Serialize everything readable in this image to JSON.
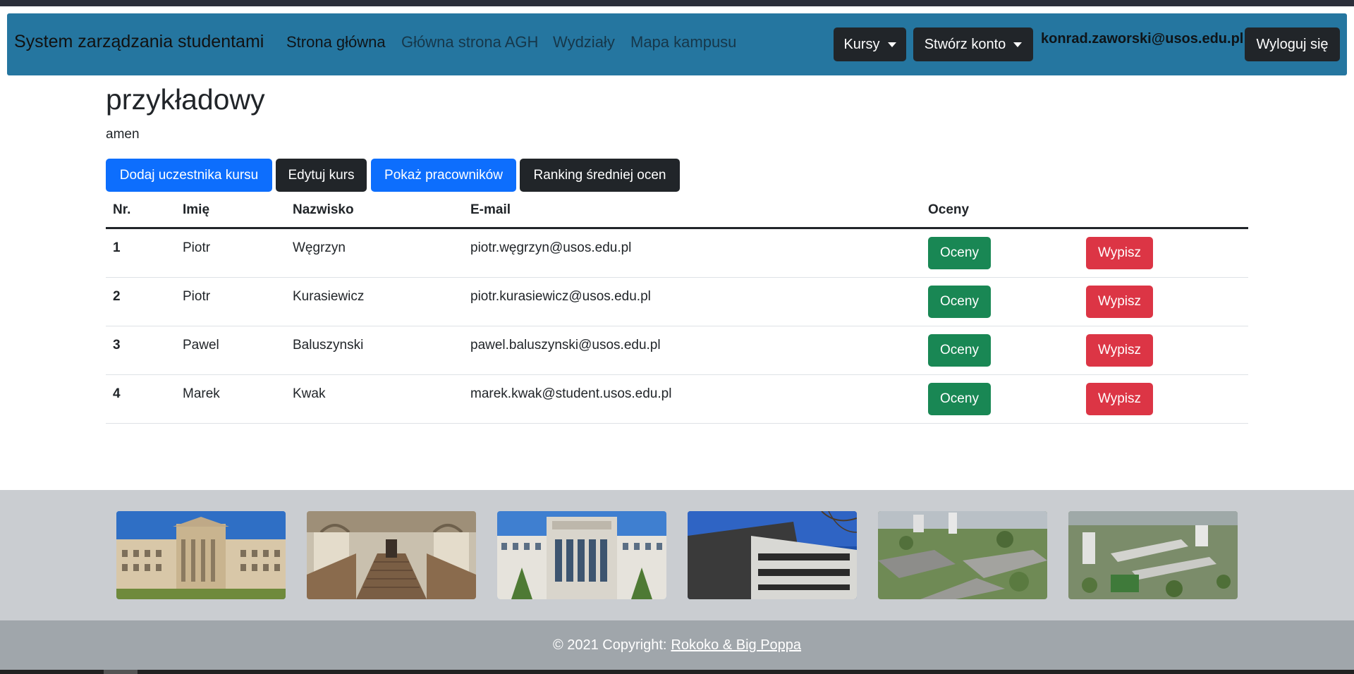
{
  "navbar": {
    "brand": "System zarządzania studentami",
    "links": [
      "Strona główna",
      "Główna strona AGH",
      "Wydziały",
      "Mapa kampusu"
    ],
    "dropdowns": [
      "Kursy",
      "Stwórz konto"
    ],
    "user_email": "konrad.zaworski@usos.edu.pl",
    "logout_label": "Wyloguj się"
  },
  "course": {
    "title": "przykładowy",
    "description": "amen"
  },
  "actions": [
    "Dodaj uczestnika kursu",
    "Edytuj kurs",
    "Pokaż pracowników",
    "Ranking średniej ocen"
  ],
  "table": {
    "headers": [
      "Nr.",
      "Imię",
      "Nazwisko",
      "E-mail",
      "Oceny"
    ],
    "rows": [
      {
        "nr": "1",
        "first": "Piotr",
        "last": "Węgrzyn",
        "email": "piotr.węgrzyn@usos.edu.pl"
      },
      {
        "nr": "2",
        "first": "Piotr",
        "last": "Kurasiewicz",
        "email": "piotr.kurasiewicz@usos.edu.pl"
      },
      {
        "nr": "3",
        "first": "Pawel",
        "last": "Baluszynski",
        "email": "pawel.baluszynski@usos.edu.pl"
      },
      {
        "nr": "4",
        "first": "Marek",
        "last": "Kwak",
        "email": "marek.kwak@student.usos.edu.pl"
      }
    ],
    "grades_label": "Oceny",
    "remove_label": "Wypisz"
  },
  "gallery": [
    "campus-building-photo",
    "grand-staircase-photo",
    "agh-main-building-photo",
    "modern-faculty-building-photo",
    "dormitory-aerial-photo",
    "campus-aerial-photo"
  ],
  "footer": {
    "copyright": "© 2021 Copyright:",
    "link": "Rokoko & Big Poppa"
  },
  "colors": {
    "navbar": "#2576a0",
    "primary": "#0d6efd",
    "dark": "#212529",
    "success": "#198754",
    "danger": "#dc3545",
    "gallery_bg": "#cacdd1",
    "footer_bg": "#a0a6ab"
  }
}
